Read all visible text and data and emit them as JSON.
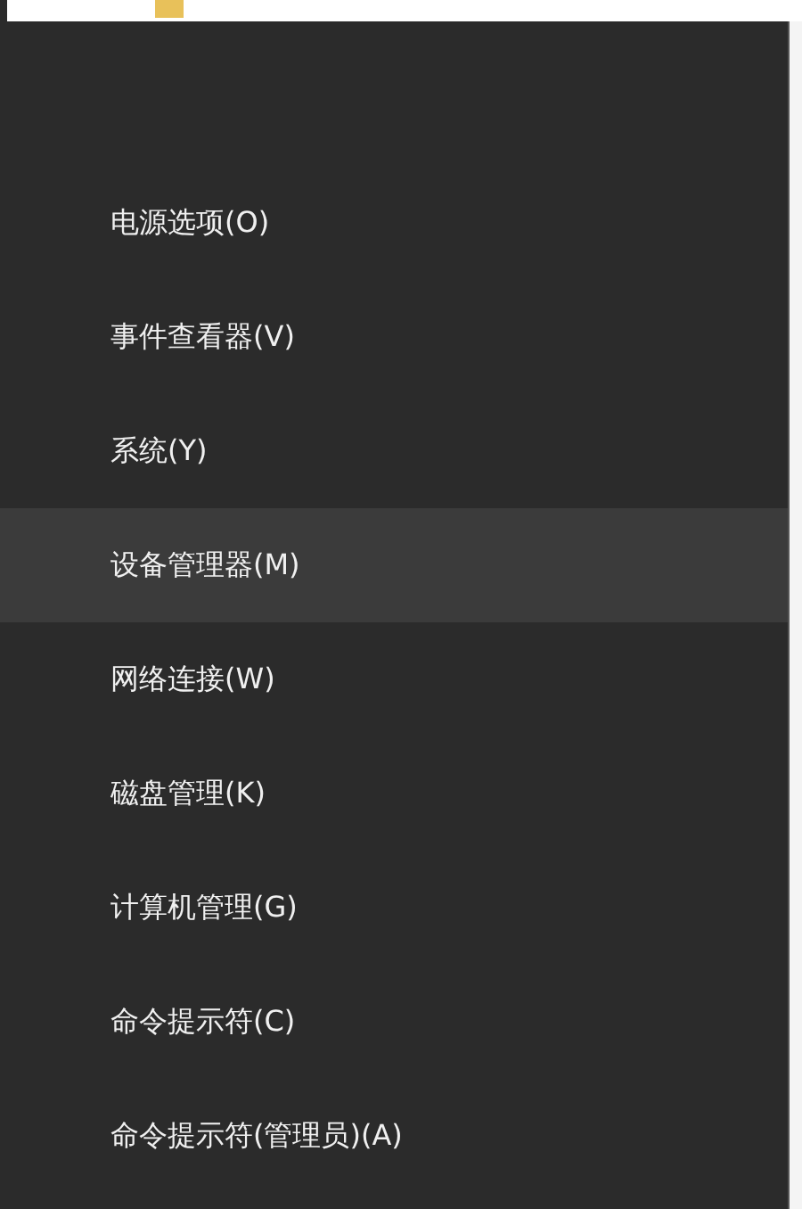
{
  "menu": {
    "items": [
      {
        "label": "电源选项(O)",
        "selected": false
      },
      {
        "label": "事件查看器(V)",
        "selected": false
      },
      {
        "label": "系统(Y)",
        "selected": false
      },
      {
        "label": "设备管理器(M)",
        "selected": true
      },
      {
        "label": "网络连接(W)",
        "selected": false
      },
      {
        "label": "磁盘管理(K)",
        "selected": false
      },
      {
        "label": "计算机管理(G)",
        "selected": false
      },
      {
        "label": "命令提示符(C)",
        "selected": false
      },
      {
        "label": "命令提示符(管理员)(A)",
        "selected": false
      }
    ]
  }
}
